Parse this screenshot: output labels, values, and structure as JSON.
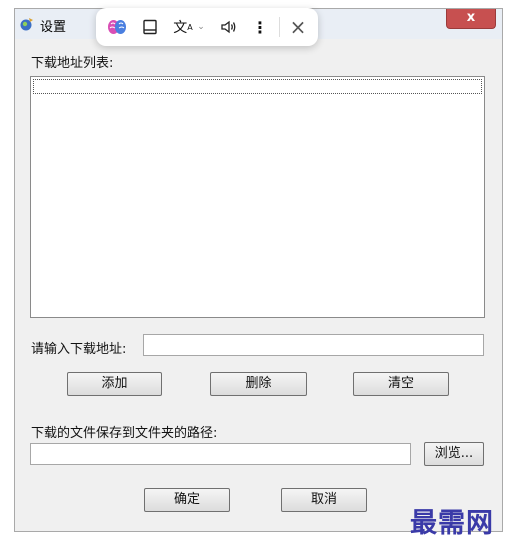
{
  "window": {
    "title": "设置",
    "close_label": "x"
  },
  "mini_toolbar": {
    "icons": [
      "brain-icon",
      "book-icon",
      "translate-icon",
      "chevron-down-icon",
      "speaker-icon",
      "more-icon",
      "close-icon"
    ]
  },
  "download_list": {
    "label": "下载地址列表:"
  },
  "url_input": {
    "label": "请输入下载地址:",
    "value": ""
  },
  "buttons": {
    "add": "添加",
    "delete": "删除",
    "clear": "清空"
  },
  "save_path": {
    "label": "下载的文件保存到文件夹的路径:",
    "value": "",
    "browse": "浏览..."
  },
  "footer": {
    "ok": "确定",
    "cancel": "取消"
  },
  "watermark": "最需网"
}
